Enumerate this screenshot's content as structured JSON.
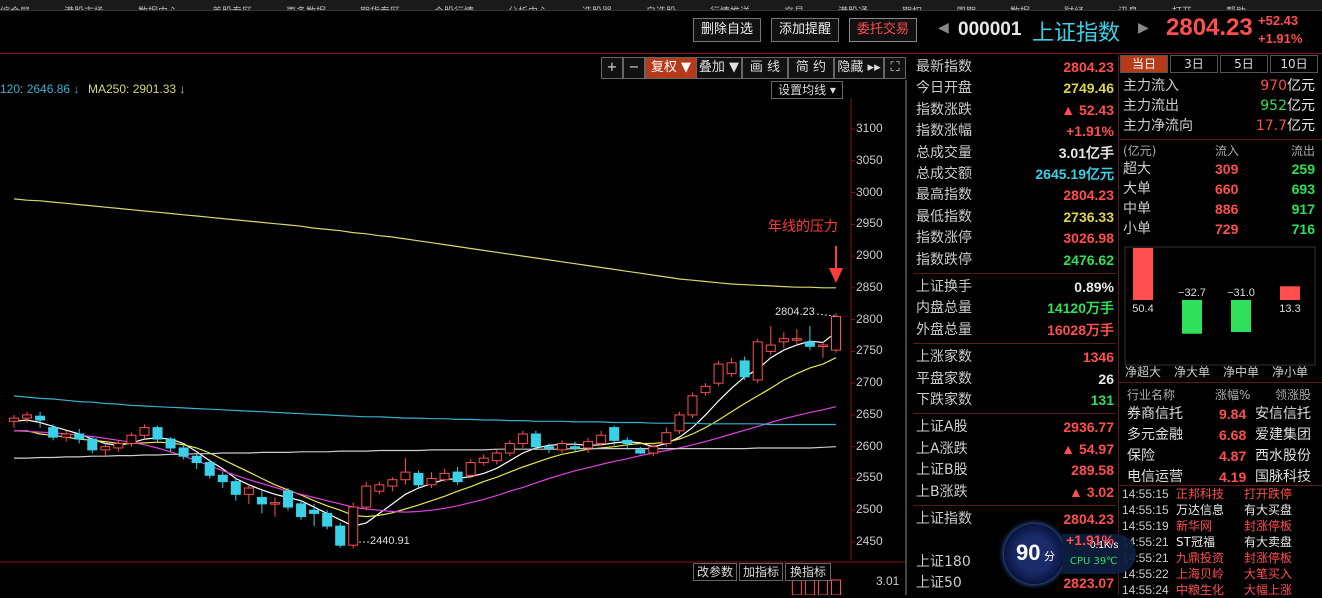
{
  "top_menu": [
    "综合屏",
    "港股市场",
    "数据中心",
    "美股专区",
    "更多数据",
    "期货专区",
    "个股行情",
    "分析中心",
    "选股器",
    "自选股",
    "行情推送",
    "交易",
    "港股通",
    "期权",
    "周期",
    "数据",
    "财经",
    "讯息",
    "打开",
    "帮助"
  ],
  "header": {
    "delete_fav": "删除自选",
    "add_alert": "添加提醒",
    "trade": "委托交易",
    "code": "000001",
    "name": "上证指数",
    "price": "2804.23",
    "change": "+52.43",
    "change_pct": "+1.91%",
    "nav_left": "◀",
    "nav_right": "▶"
  },
  "toolbar": {
    "zoom_in": "+",
    "zoom_out": "−",
    "adjust": "复权 ▼",
    "overlay": "叠加 ▼",
    "draw": "画 线",
    "simple": "简 约",
    "hide": "隐藏 ▸▸",
    "fullscreen": "⛶"
  },
  "ma_legend": {
    "ma120": "120: 2646.86 ↓",
    "ma250": "MA250: 2901.33 ↓",
    "set_ma": "设置均线 ▾"
  },
  "annotation": "年线的压力",
  "labels": {
    "high": "2804.23",
    "low": "2440.91",
    "sub_value": "3.01"
  },
  "sub_buttons": {
    "params": "改参数",
    "add_ind": "加指标",
    "switch_ind": "换指标"
  },
  "colors": {
    "up": "#ff4e4e",
    "down": "#2ee05a",
    "ma5": "#ffffff",
    "ma10": "#e8e84a",
    "ma20": "#e040e0",
    "ma120": "#3ab0d0",
    "ma250": "#d8d870"
  },
  "chart_data": {
    "type": "candlestick",
    "y_axis_ticks": [
      3100,
      3050,
      3000,
      2950,
      2900,
      2850,
      2800,
      2750,
      2700,
      2650,
      2600,
      2550,
      2500,
      2450
    ],
    "ylim": [
      2430,
      3130
    ],
    "candles": [
      [
        2640,
        2645,
        2630,
        2650
      ],
      [
        2645,
        2650,
        2638,
        2655
      ],
      [
        2648,
        2642,
        2630,
        2655
      ],
      [
        2630,
        2615,
        2610,
        2635
      ],
      [
        2615,
        2620,
        2608,
        2625
      ],
      [
        2620,
        2612,
        2605,
        2628
      ],
      [
        2612,
        2595,
        2590,
        2615
      ],
      [
        2595,
        2600,
        2585,
        2605
      ],
      [
        2598,
        2605,
        2592,
        2610
      ],
      [
        2605,
        2618,
        2600,
        2622
      ],
      [
        2618,
        2630,
        2612,
        2635
      ],
      [
        2630,
        2612,
        2608,
        2633
      ],
      [
        2612,
        2598,
        2592,
        2615
      ],
      [
        2598,
        2585,
        2580,
        2602
      ],
      [
        2585,
        2575,
        2565,
        2590
      ],
      [
        2575,
        2555,
        2550,
        2580
      ],
      [
        2555,
        2545,
        2535,
        2560
      ],
      [
        2545,
        2525,
        2515,
        2550
      ],
      [
        2525,
        2535,
        2510,
        2540
      ],
      [
        2520,
        2510,
        2495,
        2530
      ],
      [
        2510,
        2512,
        2490,
        2520
      ],
      [
        2530,
        2505,
        2500,
        2535
      ],
      [
        2510,
        2490,
        2485,
        2515
      ],
      [
        2500,
        2495,
        2475,
        2510
      ],
      [
        2495,
        2475,
        2470,
        2500
      ],
      [
        2475,
        2445,
        2440.91,
        2480
      ],
      [
        2445,
        2505,
        2440,
        2512
      ],
      [
        2505,
        2538,
        2500,
        2545
      ],
      [
        2530,
        2540,
        2525,
        2545
      ],
      [
        2538,
        2548,
        2530,
        2552
      ],
      [
        2548,
        2560,
        2540,
        2582
      ],
      [
        2558,
        2540,
        2535,
        2562
      ],
      [
        2540,
        2550,
        2535,
        2560
      ],
      [
        2548,
        2558,
        2545,
        2565
      ],
      [
        2560,
        2545,
        2540,
        2568
      ],
      [
        2555,
        2575,
        2550,
        2580
      ],
      [
        2575,
        2582,
        2570,
        2588
      ],
      [
        2578,
        2590,
        2572,
        2595
      ],
      [
        2590,
        2605,
        2585,
        2610
      ],
      [
        2605,
        2620,
        2598,
        2625
      ],
      [
        2620,
        2600,
        2595,
        2625
      ],
      [
        2600,
        2598,
        2590,
        2605
      ],
      [
        2595,
        2605,
        2590,
        2610
      ],
      [
        2600,
        2598,
        2592,
        2608
      ],
      [
        2598,
        2608,
        2590,
        2614
      ],
      [
        2605,
        2618,
        2602,
        2625
      ],
      [
        2630,
        2610,
        2602,
        2633
      ],
      [
        2610,
        2605,
        2595,
        2615
      ],
      [
        2595,
        2590,
        2588,
        2600
      ],
      [
        2590,
        2600,
        2585,
        2605
      ],
      [
        2605,
        2622,
        2600,
        2630
      ],
      [
        2625,
        2650,
        2620,
        2655
      ],
      [
        2650,
        2680,
        2645,
        2685
      ],
      [
        2685,
        2695,
        2680,
        2700
      ],
      [
        2700,
        2730,
        2695,
        2735
      ],
      [
        2715,
        2732,
        2710,
        2740
      ],
      [
        2735,
        2710,
        2705,
        2742
      ],
      [
        2705,
        2765,
        2700,
        2770
      ],
      [
        2750,
        2760,
        2745,
        2790
      ],
      [
        2765,
        2770,
        2755,
        2780
      ],
      [
        2770,
        2770,
        2760,
        2785
      ],
      [
        2765,
        2758,
        2752,
        2790
      ],
      [
        2760,
        2760,
        2740,
        2765
      ],
      [
        2752,
        2805,
        2748,
        2810
      ]
    ],
    "ma_lines": {
      "ma5": [
        2640,
        2642,
        2638,
        2632,
        2626,
        2620,
        2612,
        2605,
        2602,
        2606,
        2612,
        2614,
        2612,
        2605,
        2592,
        2578,
        2565,
        2550,
        2540,
        2532,
        2525,
        2520,
        2515,
        2505,
        2495,
        2485,
        2475,
        2480,
        2495,
        2510,
        2525,
        2535,
        2542,
        2548,
        2550,
        2553,
        2558,
        2566,
        2578,
        2590,
        2598,
        2602,
        2604,
        2604,
        2602,
        2603,
        2606,
        2608,
        2606,
        2600,
        2605,
        2615,
        2630,
        2650,
        2672,
        2692,
        2710,
        2722,
        2740,
        2752,
        2760,
        2766,
        2764,
        2780
      ],
      "ma10": [
        2625,
        2625,
        2620,
        2618,
        2615,
        2612,
        2610,
        2608,
        2605,
        2605,
        2606,
        2607,
        2606,
        2603,
        2598,
        2590,
        2580,
        2570,
        2560,
        2550,
        2540,
        2532,
        2524,
        2515,
        2507,
        2500,
        2492,
        2490,
        2492,
        2496,
        2502,
        2508,
        2515,
        2522,
        2530,
        2537,
        2545,
        2552,
        2560,
        2568,
        2575,
        2582,
        2588,
        2592,
        2596,
        2598,
        2600,
        2603,
        2605,
        2605,
        2607,
        2612,
        2620,
        2630,
        2642,
        2655,
        2668,
        2680,
        2692,
        2705,
        2715,
        2724,
        2730,
        2740
      ],
      "ma20": [
        2625,
        2624,
        2623,
        2622,
        2620,
        2618,
        2616,
        2613,
        2610,
        2607,
        2603,
        2598,
        2592,
        2585,
        2578,
        2570,
        2562,
        2555,
        2548,
        2542,
        2536,
        2530,
        2525,
        2520,
        2515,
        2510,
        2505,
        2502,
        2500,
        2498,
        2497,
        2498,
        2500,
        2503,
        2507,
        2512,
        2517,
        2523,
        2530,
        2536,
        2543,
        2550,
        2556,
        2562,
        2567,
        2572,
        2577,
        2581,
        2586,
        2590,
        2594,
        2598,
        2603,
        2608,
        2614,
        2620,
        2626,
        2632,
        2638,
        2644,
        2649,
        2654,
        2658,
        2663
      ],
      "ma120": [
        2680,
        2678,
        2676,
        2675,
        2673,
        2671,
        2670,
        2668,
        2667,
        2665,
        2664,
        2663,
        2662,
        2661,
        2660,
        2659,
        2658,
        2657,
        2656,
        2655,
        2654,
        2653,
        2652,
        2651,
        2650,
        2649,
        2648,
        2647,
        2647,
        2646,
        2645,
        2645,
        2644,
        2644,
        2643,
        2643,
        2642,
        2642,
        2641,
        2641,
        2640,
        2640,
        2640,
        2639,
        2639,
        2639,
        2638,
        2638,
        2638,
        2637,
        2637,
        2637,
        2637,
        2636,
        2636,
        2636,
        2636,
        2636,
        2635,
        2635,
        2635,
        2635,
        2635,
        2635
      ],
      "ma250": [
        2990,
        2988,
        2987,
        2985,
        2983,
        2981,
        2979,
        2977,
        2975,
        2973,
        2971,
        2969,
        2967,
        2965,
        2963,
        2961,
        2959,
        2957,
        2955,
        2953,
        2951,
        2949,
        2947,
        2944,
        2942,
        2940,
        2937,
        2935,
        2932,
        2930,
        2927,
        2924,
        2921,
        2918,
        2915,
        2912,
        2909,
        2906,
        2903,
        2900,
        2897,
        2894,
        2891,
        2888,
        2885,
        2882,
        2879,
        2876,
        2873,
        2870,
        2867,
        2864,
        2862,
        2860,
        2858,
        2856,
        2855,
        2854,
        2853,
        2852,
        2851,
        2851,
        2850,
        2850
      ],
      "long": [
        2582,
        2582,
        2583,
        2583,
        2584,
        2584,
        2585,
        2585,
        2586,
        2586,
        2587,
        2587,
        2588,
        2588,
        2589,
        2589,
        2590,
        2590,
        2590,
        2591,
        2591,
        2591,
        2592,
        2592,
        2592,
        2593,
        2593,
        2593,
        2594,
        2594,
        2594,
        2594,
        2595,
        2595,
        2595,
        2595,
        2595,
        2596,
        2596,
        2596,
        2596,
        2596,
        2596,
        2597,
        2597,
        2597,
        2597,
        2597,
        2597,
        2597,
        2597,
        2597,
        2597,
        2597,
        2597,
        2597,
        2597,
        2598,
        2598,
        2598,
        2598,
        2598,
        2599,
        2600
      ]
    }
  },
  "info_panel": {
    "rows1": [
      {
        "k": "最新指数",
        "v": "2804.23",
        "c": "r"
      },
      {
        "k": "今日开盘",
        "v": "2749.46",
        "c": "y"
      },
      {
        "k": "指数涨跌",
        "v": "▲ 52.43",
        "c": "r"
      },
      {
        "k": "指数涨幅",
        "v": "+1.91%",
        "c": "r"
      },
      {
        "k": "总成交量",
        "v": "3.01亿手",
        "c": "w"
      },
      {
        "k": "总成交额",
        "v": "2645.19亿元",
        "c": "c"
      },
      {
        "k": "最高指数",
        "v": "2804.23",
        "c": "r"
      },
      {
        "k": "最低指数",
        "v": "2736.33",
        "c": "y"
      },
      {
        "k": "指数涨停",
        "v": "3026.98",
        "c": "r"
      },
      {
        "k": "指数跌停",
        "v": "2476.62",
        "c": "g"
      }
    ],
    "rows2": [
      {
        "k": "上证换手",
        "v": "0.89%",
        "c": "w"
      },
      {
        "k": "内盘总量",
        "v": "14120万手",
        "c": "g"
      },
      {
        "k": "外盘总量",
        "v": "16028万手",
        "c": "r"
      }
    ],
    "rows3": [
      {
        "k": "上涨家数",
        "v": "1346",
        "c": "r"
      },
      {
        "k": "平盘家数",
        "v": "26",
        "c": "w"
      },
      {
        "k": "下跌家数",
        "v": "131",
        "c": "g"
      }
    ],
    "rows4": [
      {
        "k": "上证A股",
        "v": "2936.77",
        "c": "r"
      },
      {
        "k": "上A涨跌",
        "v": "▲ 54.97",
        "c": "r"
      },
      {
        "k": "上证B股",
        "v": "289.58",
        "c": "r"
      },
      {
        "k": "上B涨跌",
        "v": "▲ 3.02",
        "c": "r"
      }
    ],
    "rows5": [
      {
        "k": "上证指数",
        "v": "2804.23",
        "c": "r"
      },
      {
        "k": "",
        "v": "+1.91%",
        "c": "r"
      },
      {
        "k": "上证180",
        "v": "",
        "c": "w"
      },
      {
        "k": "上证50",
        "v": "2823.07",
        "c": "r"
      }
    ]
  },
  "flow_panel": {
    "tabs": [
      "当日",
      "3日",
      "5日",
      "10日"
    ],
    "main": [
      {
        "k": "主力流入",
        "v": "970",
        "u": "亿元",
        "c": "r"
      },
      {
        "k": "主力流出",
        "v": "952",
        "u": "亿元",
        "c": "g"
      },
      {
        "k": "主力净流向",
        "v": "17.7",
        "u": "亿元",
        "c": "r"
      }
    ],
    "header": [
      "(亿元)",
      "流入",
      "流出"
    ],
    "sizes": [
      {
        "k": "超大",
        "in": "309",
        "out": "259"
      },
      {
        "k": "大单",
        "in": "660",
        "out": "693"
      },
      {
        "k": "中单",
        "in": "886",
        "out": "917"
      },
      {
        "k": "小单",
        "in": "729",
        "out": "716"
      }
    ],
    "bars": [
      {
        "label": "净超大",
        "value": 50.4,
        "text": "50.4"
      },
      {
        "label": "净大单",
        "value": -32.7,
        "text": "−32.7"
      },
      {
        "label": "净中单",
        "value": -31.0,
        "text": "−31.0"
      },
      {
        "label": "净小单",
        "value": 13.3,
        "text": "13.3"
      }
    ],
    "industry_header": [
      "行业名称",
      "涨幅%",
      "领涨股"
    ],
    "industries": [
      {
        "name": "券商信托",
        "pct": "9.84",
        "lead": "安信信托"
      },
      {
        "name": "多元金融",
        "pct": "6.68",
        "lead": "爱建集团"
      },
      {
        "name": "保险",
        "pct": "4.87",
        "lead": "西水股份"
      },
      {
        "name": "电信运营",
        "pct": "4.19",
        "lead": "国脉科技"
      }
    ],
    "news": [
      {
        "t": "14:55:15",
        "s": "正邦科技",
        "e": "打开跌停"
      },
      {
        "t": "14:55:15",
        "s": "万达信息",
        "e": "有大买盘"
      },
      {
        "t": "14:55:19",
        "s": "新华网",
        "e": "封涨停板"
      },
      {
        "t": "14:55:21",
        "s": "ST冠福",
        "e": "有大卖盘"
      },
      {
        "t": "14:55:21",
        "s": "九鼎投资",
        "e": "封涨停板"
      },
      {
        "t": "14:55:22",
        "s": "上海贝岭",
        "e": "大笔买入"
      },
      {
        "t": "14:55:24",
        "s": "中粮生化",
        "e": "大幅上涨"
      }
    ]
  },
  "widget": {
    "score": "90",
    "unit": "分",
    "speed": "0.1K/s",
    "cpu": "CPU 39℃"
  }
}
